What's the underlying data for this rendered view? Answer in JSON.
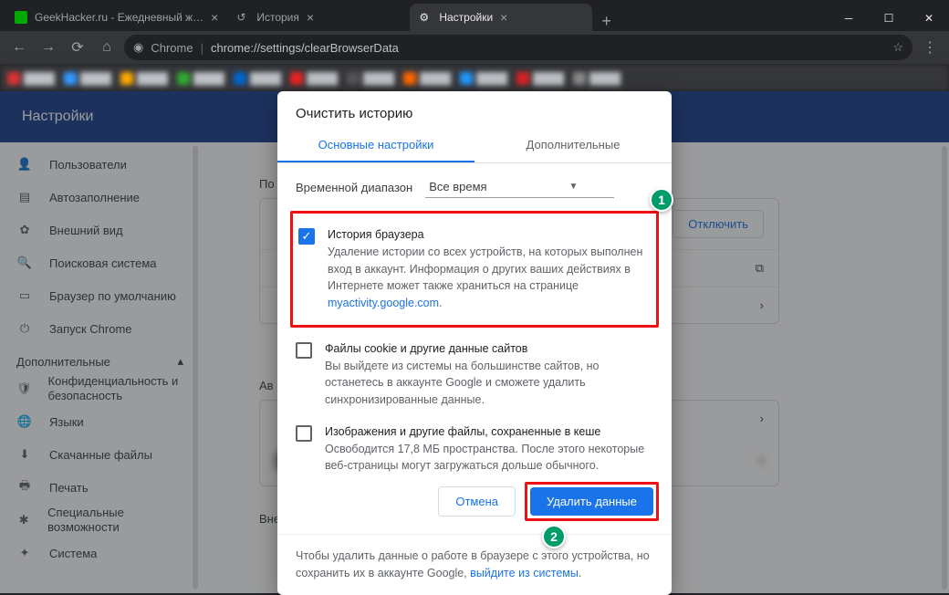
{
  "browser": {
    "tabs": [
      {
        "title": "GeekHacker.ru - Ежедневный ж…",
        "active": false
      },
      {
        "title": "История",
        "active": false
      },
      {
        "title": "Настройки",
        "active": true
      }
    ],
    "url_protocol": "Chrome",
    "url_path": "chrome://settings/clearBrowserData"
  },
  "page": {
    "header": "Настройки"
  },
  "sidebar": {
    "items": [
      {
        "label": "Пользователи"
      },
      {
        "label": "Автозаполнение"
      },
      {
        "label": "Внешний вид"
      },
      {
        "label": "Поисковая система"
      },
      {
        "label": "Браузер по умолчанию"
      },
      {
        "label": "Запуск Chrome"
      }
    ],
    "section": "Дополнительные",
    "adv": [
      {
        "label": "Конфиденциальность и безопасность"
      },
      {
        "label": "Языки"
      },
      {
        "label": "Скачанные файлы"
      },
      {
        "label": "Печать"
      },
      {
        "label": "Специальные возможности"
      },
      {
        "label": "Система"
      }
    ]
  },
  "main": {
    "sec1": "По",
    "btn_off": "Отключить",
    "sec2": "Ав",
    "sec3": "Внешний вид"
  },
  "modal": {
    "title": "Очистить историю",
    "tab1": "Основные настройки",
    "tab2": "Дополнительные",
    "range_label": "Временной диапазон",
    "range_value": "Все время",
    "opts": [
      {
        "title": "История браузера",
        "desc_a": "Удаление истории со всех устройств, на которых выполнен вход в аккаунт. Информация о других ваших действиях в Интернете может также храниться на странице ",
        "link": "myactivity.google.com",
        "checked": true
      },
      {
        "title": "Файлы cookie и другие данные сайтов",
        "desc": "Вы выйдете из системы на большинстве сайтов, но останетесь в аккаунте Google и сможете удалить синхронизированные данные.",
        "checked": false
      },
      {
        "title": "Изображения и другие файлы, сохраненные в кеше",
        "desc": "Освободится 17,8 МБ пространства. После этого некоторые веб-страницы могут загружаться дольше обычного.",
        "checked": false
      }
    ],
    "note_a": "Чтобы удалить данные о работе в браузере с этого устройства, но сохранить их в аккаунте Google, ",
    "note_link": "выйдите из системы",
    "btn_cancel": "Отмена",
    "btn_delete": "Удалить данные"
  },
  "annotations": {
    "b1": "1",
    "b2": "2"
  }
}
